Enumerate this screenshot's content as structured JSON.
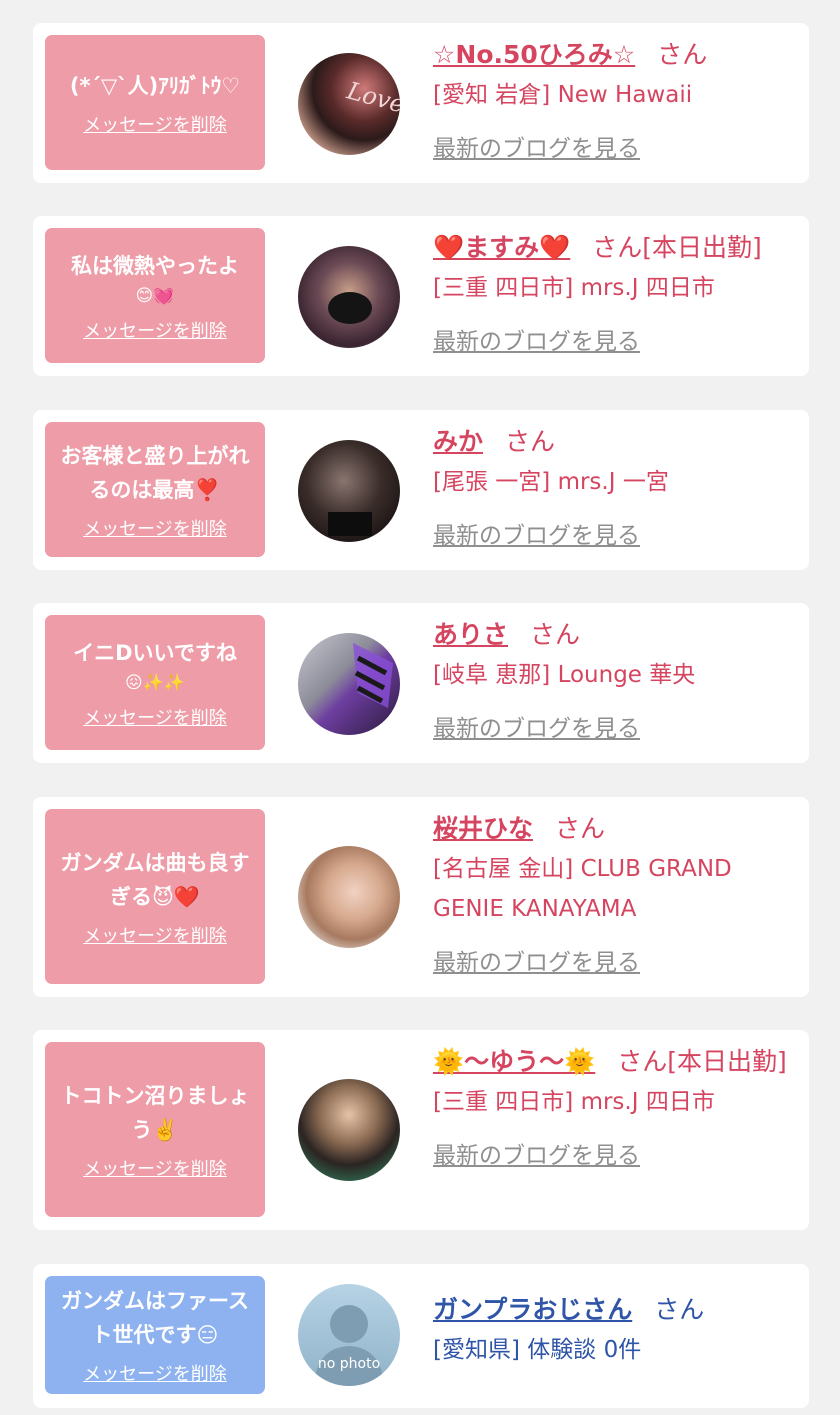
{
  "items": [
    {
      "message": "(*´▽`人)ｱﾘｶﾞﾄｳ♡",
      "emoji": "",
      "delete_label": "メッセージを削除",
      "name": "☆No.50ひろみ☆",
      "suffix": "さん",
      "shop": "[愛知 岩倉] New Hawaii",
      "blog_label": "最新のブログを見る"
    },
    {
      "message": "私は微熱やったよ",
      "emoji": "😊💓",
      "delete_label": "メッセージを削除",
      "name": "❤️ますみ❤️",
      "suffix": "さん[本日出勤]",
      "shop": "[三重 四日市] mrs.J 四日市",
      "blog_label": "最新のブログを見る"
    },
    {
      "message": "お客様と盛り上がれるのは最高❣️",
      "emoji": "",
      "delete_label": "メッセージを削除",
      "name": "みか",
      "suffix": "さん",
      "shop": "[尾張 一宮] mrs.J 一宮",
      "blog_label": "最新のブログを見る"
    },
    {
      "message": "イニDいいですね",
      "emoji": "😖✨✨",
      "delete_label": "メッセージを削除",
      "name": "ありさ",
      "suffix": "さん",
      "shop": "[岐阜 恵那] Lounge 華央",
      "blog_label": "最新のブログを見る"
    },
    {
      "message": "ガンダムは曲も良すぎる😈❤️",
      "emoji": "",
      "delete_label": "メッセージを削除",
      "name": "桜井ひな",
      "suffix": "さん",
      "shop": "[名古屋 金山] CLUB GRAND GENIE KANAYAMA",
      "blog_label": "最新のブログを見る"
    },
    {
      "message": "トコトン沼りましょう✌️",
      "emoji": "",
      "delete_label": "メッセージを削除",
      "name": "🌞〜ゆう〜🌞",
      "suffix": "さん[本日出勤]",
      "shop": "[三重 四日市] mrs.J 四日市",
      "blog_label": "最新のブログを見る"
    },
    {
      "message": "ガンダムはファースト世代です😑",
      "emoji": "",
      "delete_label": "メッセージを削除",
      "name": "ガンプラおじさん",
      "suffix": "さん",
      "shop": "[愛知県] 体験談 0件",
      "no_photo_label": "no photo"
    }
  ],
  "colors": {
    "bubble_pink": "#ee9ca7",
    "bubble_blue": "#8db2ef",
    "name_red": "#d64560",
    "name_blue": "#2f55a8",
    "blog_gray": "#8f8f8f"
  }
}
